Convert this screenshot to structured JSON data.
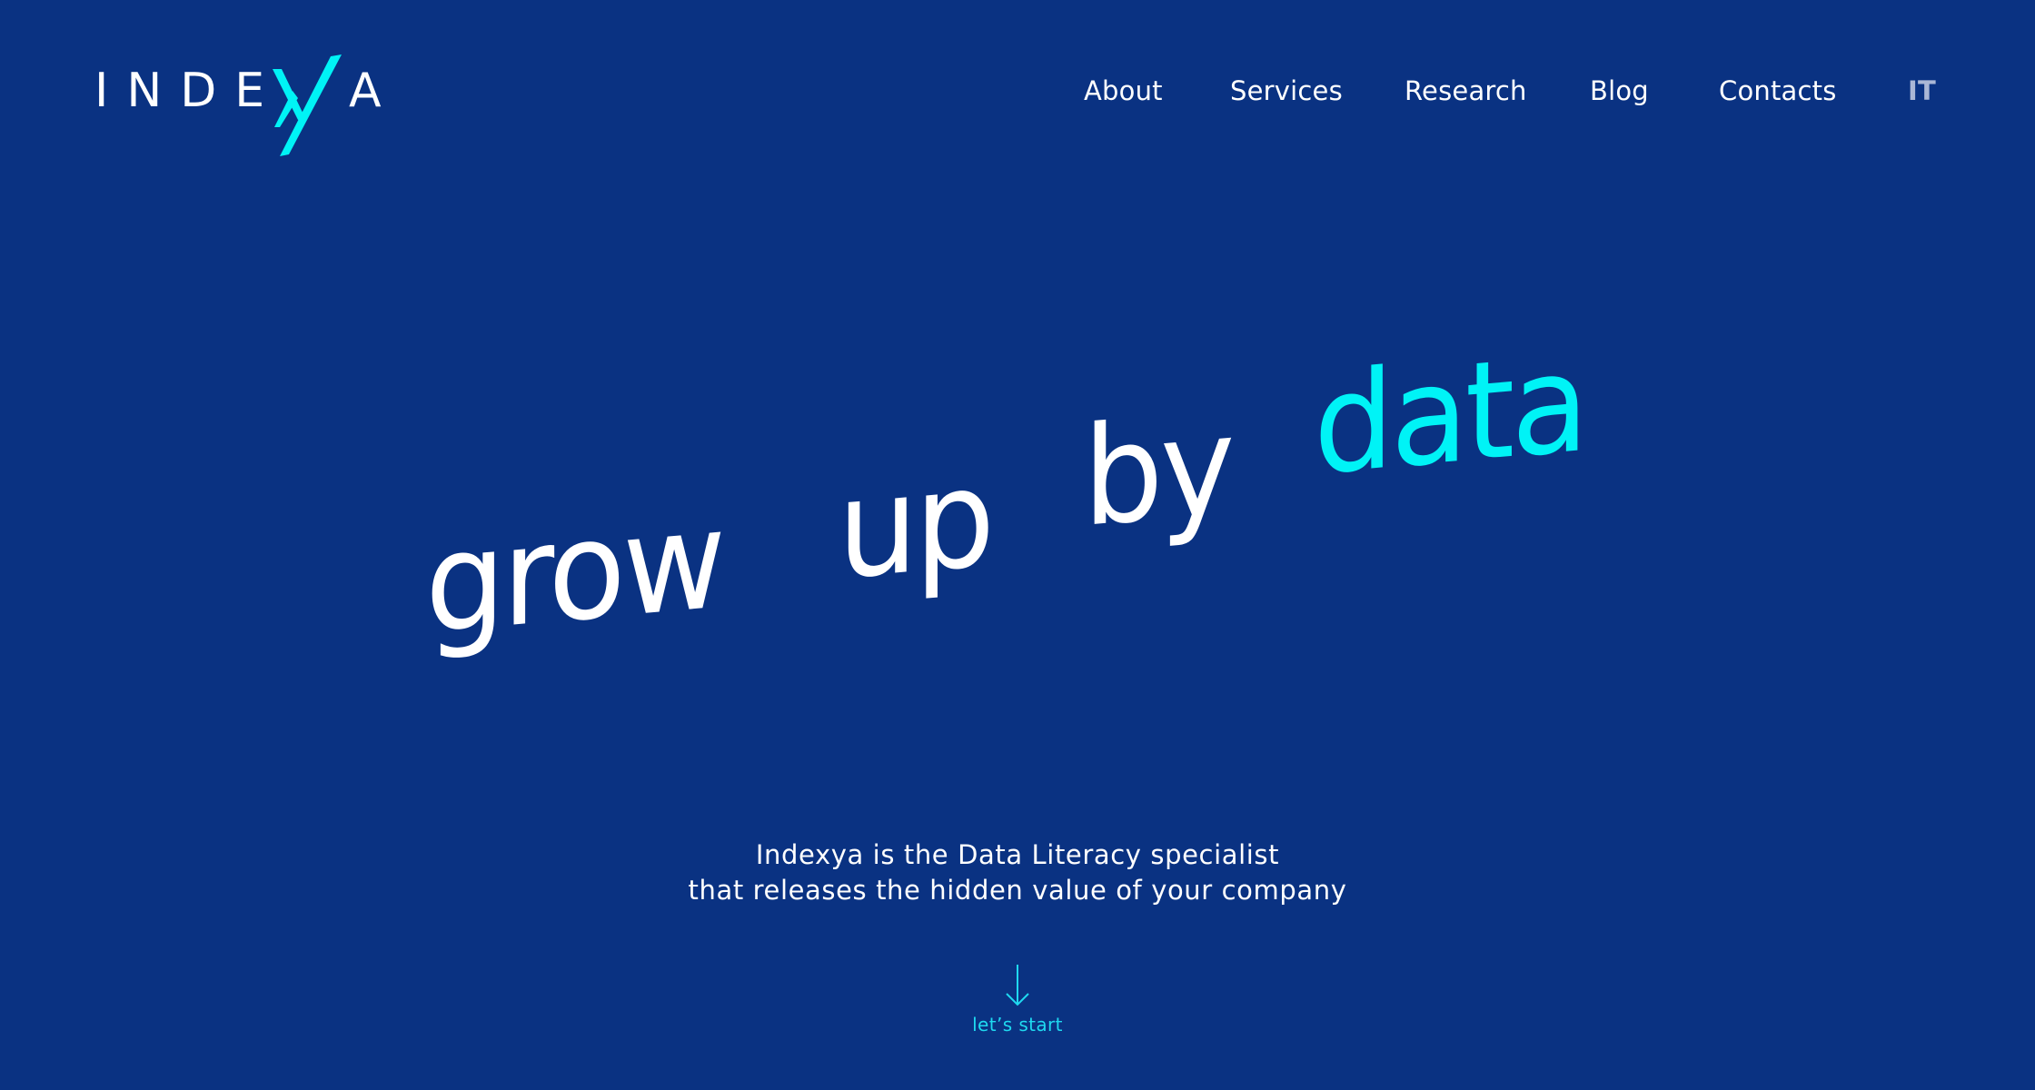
{
  "brand": {
    "logo_left": "INDE",
    "logo_right": "A",
    "logo_mark": "xy-mark-icon",
    "colors": {
      "background": "#0a3282",
      "accent": "#00f3f6",
      "text": "#ffffff",
      "lang_muted": "#aab7d6"
    }
  },
  "nav": {
    "items": [
      {
        "label": "About"
      },
      {
        "label": "Services"
      },
      {
        "label": "Research"
      },
      {
        "label": "Blog"
      },
      {
        "label": "Contacts"
      }
    ],
    "language": "IT"
  },
  "hero": {
    "words": [
      "grow",
      "up",
      "by",
      "data"
    ],
    "tagline_line1": "Indexya is the Data Literacy specialist",
    "tagline_line2": "that releases the hidden value of your company",
    "cta_label": "let’s start",
    "cta_icon": "arrow-down-icon"
  }
}
